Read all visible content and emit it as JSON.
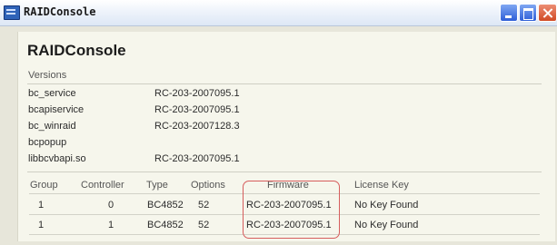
{
  "window": {
    "title": "RAIDConsole",
    "minimize_icon": "minimize-icon",
    "maximize_icon": "maximize-icon",
    "close_icon": "close-icon"
  },
  "panel": {
    "heading": "RAIDConsole",
    "subheading": "Versions"
  },
  "versions": [
    {
      "name": "bc_service",
      "version": "RC-203-2007095.1"
    },
    {
      "name": "bcapiservice",
      "version": "RC-203-2007095.1"
    },
    {
      "name": "bc_winraid",
      "version": "RC-203-2007128.3"
    },
    {
      "name": "bcpopup",
      "version": ""
    },
    {
      "name": "libbcvbapi.so",
      "version": "RC-203-2007095.1"
    }
  ],
  "controllers": {
    "headers": [
      "Group",
      "Controller",
      "Type",
      "Options",
      "Firmware",
      "License Key"
    ],
    "rows": [
      [
        "1",
        "0",
        "BC4852",
        "52",
        "RC-203-2007095.1",
        "No Key Found"
      ],
      [
        "1",
        "1",
        "BC4852",
        "52",
        "RC-203-2007095.1",
        "No Key Found"
      ]
    ]
  },
  "colors": {
    "highlight": "#d65d5d",
    "panel": "#f6f6ec"
  }
}
